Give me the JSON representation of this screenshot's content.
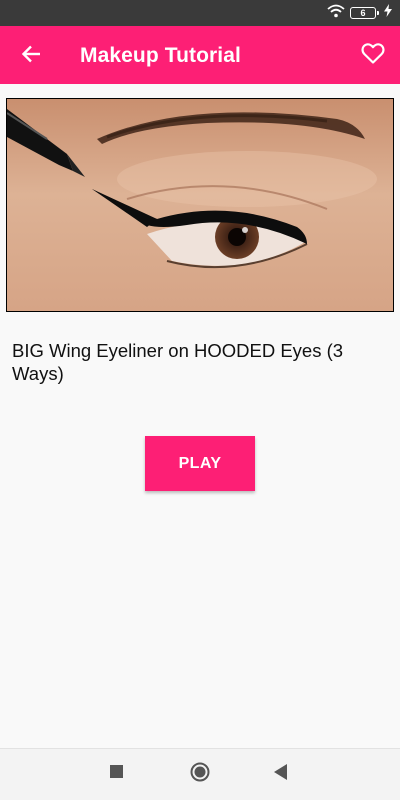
{
  "status_bar": {
    "battery_level": "6",
    "icons": [
      "wifi-icon",
      "battery-icon",
      "charging-bolt-icon"
    ]
  },
  "app_bar": {
    "title": "Makeup Tutorial",
    "back_icon": "arrow-left-icon",
    "favorite_icon": "heart-outline-icon"
  },
  "video": {
    "title": "BIG Wing Eyeliner on HOODED Eyes (3 Ways)",
    "play_label": "PLAY"
  },
  "nav_bar": {
    "icons": [
      "recent-apps-square-icon",
      "home-circle-icon",
      "back-triangle-icon"
    ]
  },
  "colors": {
    "accent": "#fd1f75",
    "status_bar": "#3a3a3a",
    "background": "#f9f9f9",
    "title_text": "#111111"
  }
}
